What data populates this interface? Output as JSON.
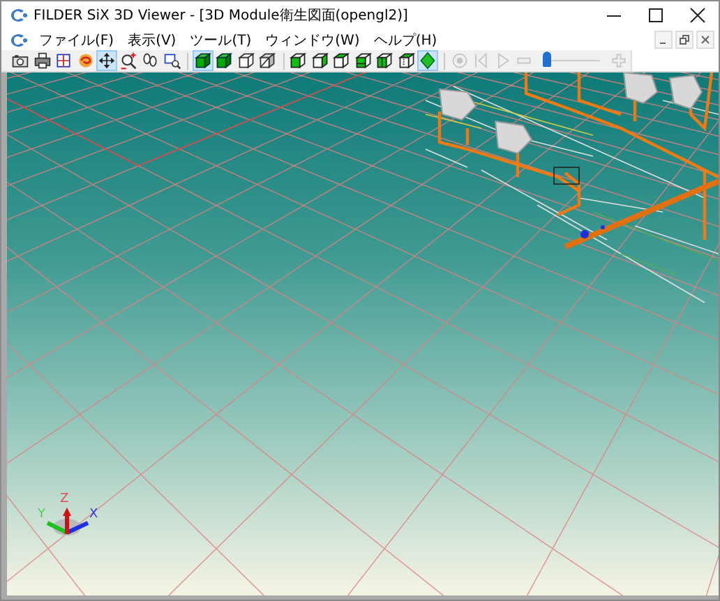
{
  "window": {
    "title": "FILDER SiX 3D Viewer - [3D Module衛生図面(opengl2)]"
  },
  "menu": [
    {
      "label": "ファイル(F)"
    },
    {
      "label": "表示(V)"
    },
    {
      "label": "ツール(T)"
    },
    {
      "label": "ウィンドウ(W)"
    },
    {
      "label": "ヘルプ(H)"
    }
  ],
  "toolbar": [
    {
      "kind": "camera",
      "selected": false,
      "disabled": false
    },
    {
      "kind": "printer",
      "selected": false,
      "disabled": false
    },
    {
      "kind": "grid",
      "selected": false,
      "disabled": false
    },
    {
      "kind": "swirl",
      "selected": false,
      "disabled": false
    },
    {
      "kind": "move",
      "selected": true,
      "disabled": false
    },
    {
      "kind": "zoom",
      "selected": false,
      "disabled": false
    },
    {
      "kind": "walk",
      "selected": false,
      "disabled": false
    },
    {
      "kind": "zoomwin",
      "selected": false,
      "disabled": false
    },
    {
      "kind": "sep"
    },
    {
      "kind": "cube-solid",
      "selected": true,
      "disabled": false
    },
    {
      "kind": "cube-solid",
      "selected": false,
      "disabled": false
    },
    {
      "kind": "cube-wire",
      "selected": false,
      "disabled": false
    },
    {
      "kind": "cube-hidden",
      "selected": false,
      "disabled": false
    },
    {
      "kind": "sep"
    },
    {
      "kind": "view-front",
      "selected": false,
      "disabled": false
    },
    {
      "kind": "view-right",
      "selected": false,
      "disabled": false
    },
    {
      "kind": "view-top",
      "selected": false,
      "disabled": false
    },
    {
      "kind": "view-bottom",
      "selected": false,
      "disabled": false
    },
    {
      "kind": "view-left",
      "selected": false,
      "disabled": false
    },
    {
      "kind": "view-back",
      "selected": false,
      "disabled": false
    },
    {
      "kind": "diamond",
      "selected": true,
      "disabled": false
    },
    {
      "kind": "sep"
    },
    {
      "kind": "record",
      "selected": false,
      "disabled": true
    },
    {
      "kind": "first",
      "selected": false,
      "disabled": true
    },
    {
      "kind": "play",
      "selected": false,
      "disabled": true
    },
    {
      "kind": "minus",
      "selected": false,
      "disabled": true
    },
    {
      "kind": "slider",
      "level": 0.05
    },
    {
      "kind": "plus",
      "selected": false,
      "disabled": true
    }
  ],
  "viewport": {
    "axes": {
      "z": "Z",
      "y": "Y",
      "x": "X"
    }
  }
}
